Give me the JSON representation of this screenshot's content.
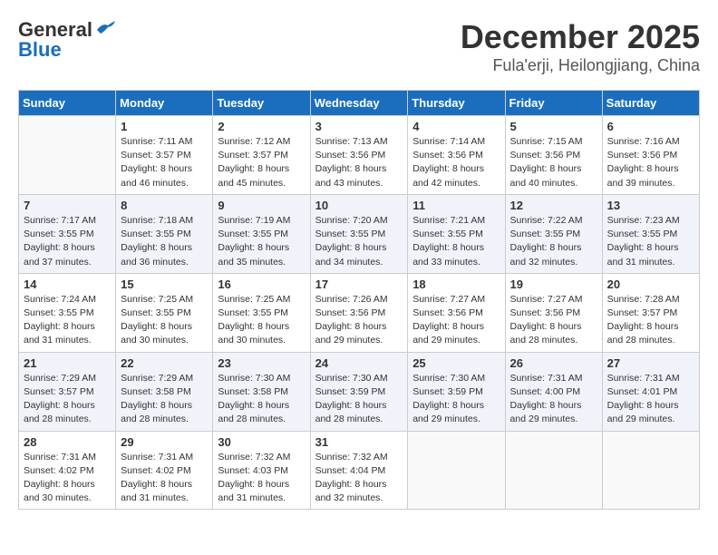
{
  "header": {
    "logo_line1": "General",
    "logo_line2": "Blue",
    "title": "December 2025",
    "subtitle": "Fula'erji, Heilongjiang, China"
  },
  "weekdays": [
    "Sunday",
    "Monday",
    "Tuesday",
    "Wednesday",
    "Thursday",
    "Friday",
    "Saturday"
  ],
  "weeks": [
    [
      {
        "day": "",
        "info": ""
      },
      {
        "day": "1",
        "info": "Sunrise: 7:11 AM\nSunset: 3:57 PM\nDaylight: 8 hours\nand 46 minutes."
      },
      {
        "day": "2",
        "info": "Sunrise: 7:12 AM\nSunset: 3:57 PM\nDaylight: 8 hours\nand 45 minutes."
      },
      {
        "day": "3",
        "info": "Sunrise: 7:13 AM\nSunset: 3:56 PM\nDaylight: 8 hours\nand 43 minutes."
      },
      {
        "day": "4",
        "info": "Sunrise: 7:14 AM\nSunset: 3:56 PM\nDaylight: 8 hours\nand 42 minutes."
      },
      {
        "day": "5",
        "info": "Sunrise: 7:15 AM\nSunset: 3:56 PM\nDaylight: 8 hours\nand 40 minutes."
      },
      {
        "day": "6",
        "info": "Sunrise: 7:16 AM\nSunset: 3:56 PM\nDaylight: 8 hours\nand 39 minutes."
      }
    ],
    [
      {
        "day": "7",
        "info": "Sunrise: 7:17 AM\nSunset: 3:55 PM\nDaylight: 8 hours\nand 37 minutes."
      },
      {
        "day": "8",
        "info": "Sunrise: 7:18 AM\nSunset: 3:55 PM\nDaylight: 8 hours\nand 36 minutes."
      },
      {
        "day": "9",
        "info": "Sunrise: 7:19 AM\nSunset: 3:55 PM\nDaylight: 8 hours\nand 35 minutes."
      },
      {
        "day": "10",
        "info": "Sunrise: 7:20 AM\nSunset: 3:55 PM\nDaylight: 8 hours\nand 34 minutes."
      },
      {
        "day": "11",
        "info": "Sunrise: 7:21 AM\nSunset: 3:55 PM\nDaylight: 8 hours\nand 33 minutes."
      },
      {
        "day": "12",
        "info": "Sunrise: 7:22 AM\nSunset: 3:55 PM\nDaylight: 8 hours\nand 32 minutes."
      },
      {
        "day": "13",
        "info": "Sunrise: 7:23 AM\nSunset: 3:55 PM\nDaylight: 8 hours\nand 31 minutes."
      }
    ],
    [
      {
        "day": "14",
        "info": "Sunrise: 7:24 AM\nSunset: 3:55 PM\nDaylight: 8 hours\nand 31 minutes."
      },
      {
        "day": "15",
        "info": "Sunrise: 7:25 AM\nSunset: 3:55 PM\nDaylight: 8 hours\nand 30 minutes."
      },
      {
        "day": "16",
        "info": "Sunrise: 7:25 AM\nSunset: 3:55 PM\nDaylight: 8 hours\nand 30 minutes."
      },
      {
        "day": "17",
        "info": "Sunrise: 7:26 AM\nSunset: 3:56 PM\nDaylight: 8 hours\nand 29 minutes."
      },
      {
        "day": "18",
        "info": "Sunrise: 7:27 AM\nSunset: 3:56 PM\nDaylight: 8 hours\nand 29 minutes."
      },
      {
        "day": "19",
        "info": "Sunrise: 7:27 AM\nSunset: 3:56 PM\nDaylight: 8 hours\nand 28 minutes."
      },
      {
        "day": "20",
        "info": "Sunrise: 7:28 AM\nSunset: 3:57 PM\nDaylight: 8 hours\nand 28 minutes."
      }
    ],
    [
      {
        "day": "21",
        "info": "Sunrise: 7:29 AM\nSunset: 3:57 PM\nDaylight: 8 hours\nand 28 minutes."
      },
      {
        "day": "22",
        "info": "Sunrise: 7:29 AM\nSunset: 3:58 PM\nDaylight: 8 hours\nand 28 minutes."
      },
      {
        "day": "23",
        "info": "Sunrise: 7:30 AM\nSunset: 3:58 PM\nDaylight: 8 hours\nand 28 minutes."
      },
      {
        "day": "24",
        "info": "Sunrise: 7:30 AM\nSunset: 3:59 PM\nDaylight: 8 hours\nand 28 minutes."
      },
      {
        "day": "25",
        "info": "Sunrise: 7:30 AM\nSunset: 3:59 PM\nDaylight: 8 hours\nand 29 minutes."
      },
      {
        "day": "26",
        "info": "Sunrise: 7:31 AM\nSunset: 4:00 PM\nDaylight: 8 hours\nand 29 minutes."
      },
      {
        "day": "27",
        "info": "Sunrise: 7:31 AM\nSunset: 4:01 PM\nDaylight: 8 hours\nand 29 minutes."
      }
    ],
    [
      {
        "day": "28",
        "info": "Sunrise: 7:31 AM\nSunset: 4:02 PM\nDaylight: 8 hours\nand 30 minutes."
      },
      {
        "day": "29",
        "info": "Sunrise: 7:31 AM\nSunset: 4:02 PM\nDaylight: 8 hours\nand 31 minutes."
      },
      {
        "day": "30",
        "info": "Sunrise: 7:32 AM\nSunset: 4:03 PM\nDaylight: 8 hours\nand 31 minutes."
      },
      {
        "day": "31",
        "info": "Sunrise: 7:32 AM\nSunset: 4:04 PM\nDaylight: 8 hours\nand 32 minutes."
      },
      {
        "day": "",
        "info": ""
      },
      {
        "day": "",
        "info": ""
      },
      {
        "day": "",
        "info": ""
      }
    ]
  ]
}
